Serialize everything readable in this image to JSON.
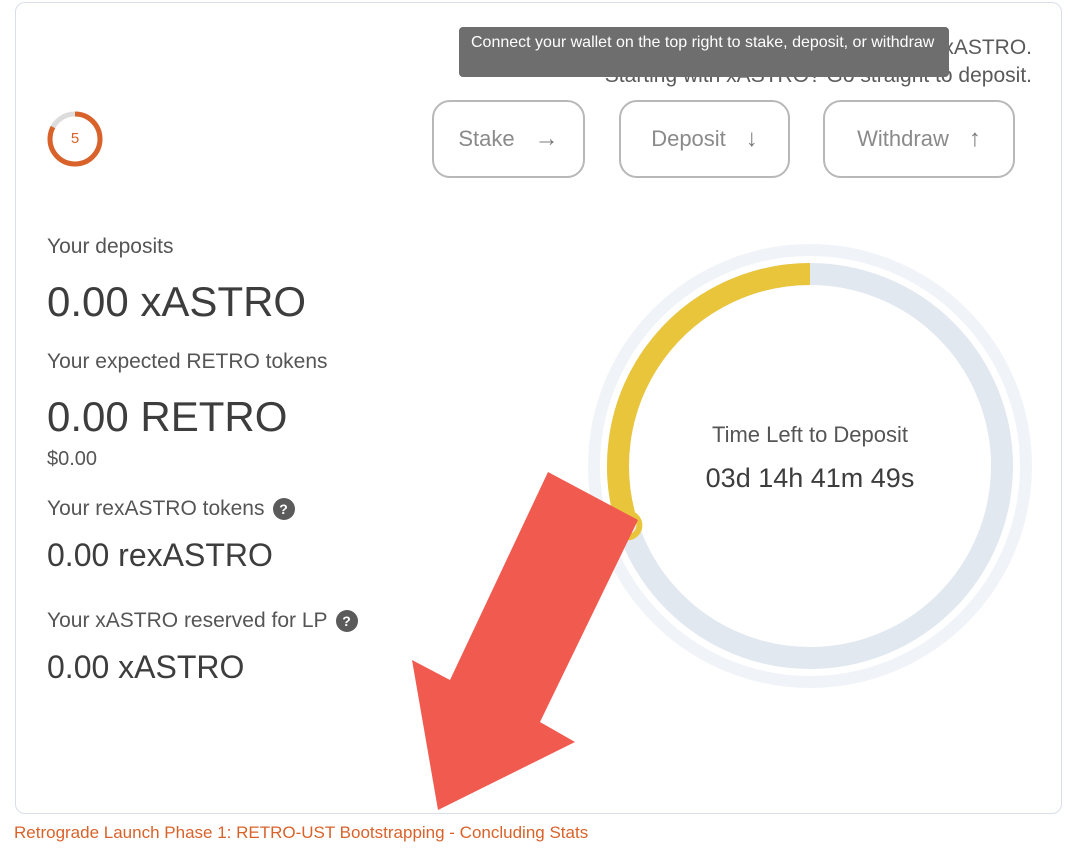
{
  "intro": {
    "line1": "Stake ASTRO to get xASTRO, or deposit xASTRO.",
    "line2": "Starting with xASTRO? Go straight to deposit."
  },
  "tooltip": {
    "text": "Connect your wallet on the top right to stake, deposit, or withdraw"
  },
  "step_indicator": {
    "number": "5",
    "color": "#d9622b"
  },
  "actions": {
    "stake": {
      "label": "Stake",
      "icon": "arrow-right-icon",
      "glyph": "→"
    },
    "deposit": {
      "label": "Deposit",
      "icon": "arrow-down-icon",
      "glyph": "↓"
    },
    "withdraw": {
      "label": "Withdraw",
      "icon": "arrow-up-icon",
      "glyph": "↑"
    }
  },
  "stats": {
    "deposits_label": "Your deposits",
    "deposits_value": "0.00 xASTRO",
    "retro_label": "Your expected RETRO tokens",
    "retro_value": "0.00 RETRO",
    "retro_usd": "$0.00",
    "rexastro_label": "Your rexASTRO tokens",
    "rexastro_value": "0.00 rexASTRO",
    "lp_label": "Your xASTRO reserved for LP",
    "lp_value": "0.00 xASTRO"
  },
  "timer": {
    "label": "Time Left to Deposit",
    "value": "03d 14h 41m 49s",
    "elapsed_fraction": 0.3,
    "progress_color": "#e8c53a",
    "track_color": "#e2e8f0"
  },
  "annotation": {
    "color": "#f05a4f"
  },
  "footer": {
    "link_text": "Retrograde Launch Phase 1: RETRO-UST Bootstrapping - Concluding Stats"
  }
}
